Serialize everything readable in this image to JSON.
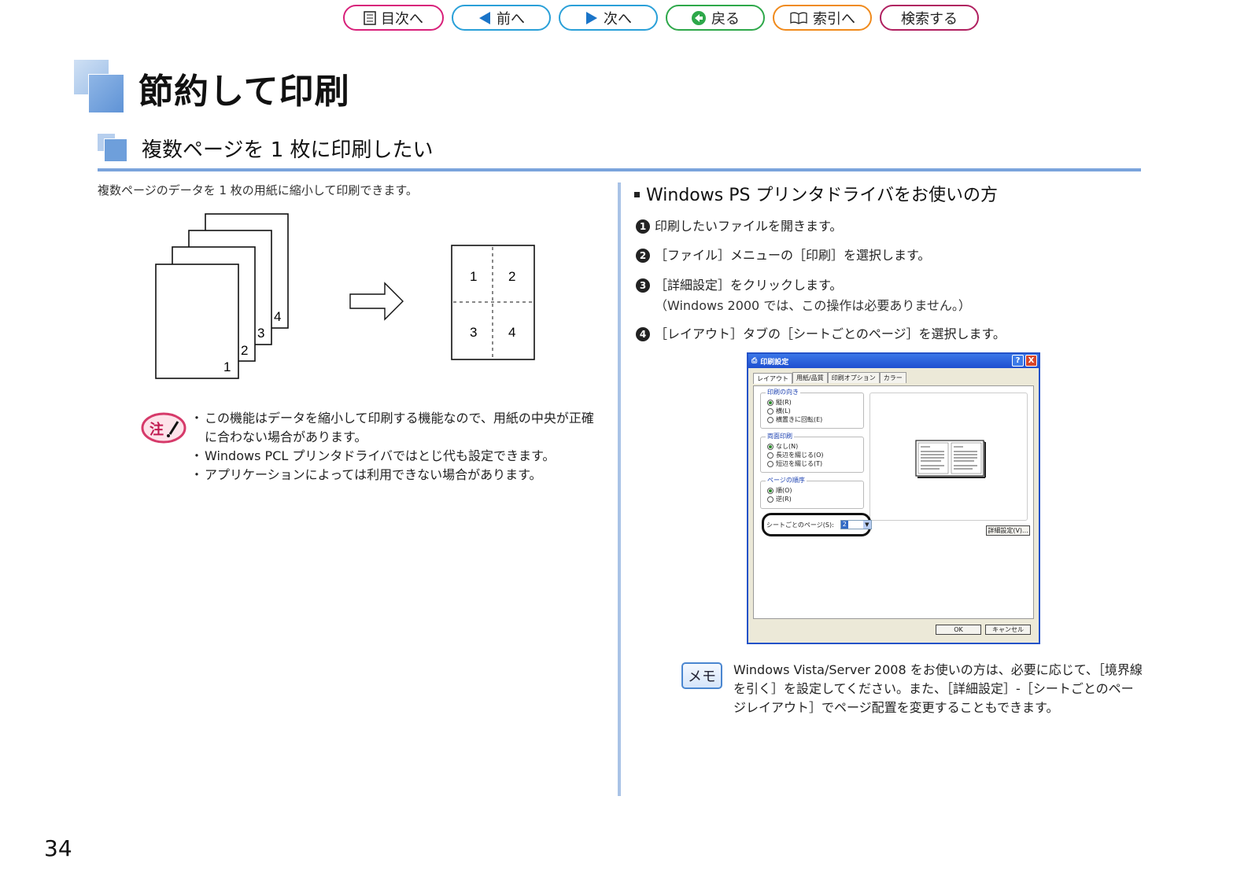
{
  "nav": {
    "toc": "目次へ",
    "prev": "前へ",
    "next": "次へ",
    "back": "戻る",
    "index": "索引へ",
    "search": "検索する",
    "colors": {
      "toc": "#d8207a",
      "prev": "#2aa0d8",
      "back": "#2ea84a",
      "index": "#f08a1c",
      "search": "#b02060"
    }
  },
  "page_title": "節約して印刷",
  "section_title": "複数ページを 1 枚に印刷したい",
  "intro": "複数ページのデータを 1 枚の用紙に縮小して印刷できます。",
  "diagram": {
    "stack_numbers": [
      "1",
      "2",
      "3",
      "4"
    ],
    "sheet_numbers": [
      "1",
      "2",
      "3",
      "4"
    ]
  },
  "note": {
    "icon_label": "注",
    "items": [
      "この機能はデータを縮小して印刷する機能なので、用紙の中央が正確に合わない場合があります。",
      "Windows PCL プリンタドライバではとじ代も設定できます。",
      "アプリケーションによっては利用できない場合があります。"
    ]
  },
  "right": {
    "subheading": "Windows PS プリンタドライバをお使いの方",
    "steps": [
      {
        "num": "1",
        "text": "印刷したいファイルを開きます。",
        "sub": ""
      },
      {
        "num": "2",
        "text": "［ファイル］メニューの［印刷］を選択します。",
        "sub": ""
      },
      {
        "num": "3",
        "text": "［詳細設定］をクリックします。",
        "sub": "（Windows 2000 では、この操作は必要ありません。）"
      },
      {
        "num": "4",
        "text": "［レイアウト］タブの［シートごとのページ］を選択します。",
        "sub": ""
      }
    ]
  },
  "dialog": {
    "title": "印刷設定",
    "help_btn": "?",
    "close_btn": "X",
    "tabs": [
      "レイアウト",
      "用紙/品質",
      "印刷オプション",
      "カラー"
    ],
    "orientation": {
      "legend": "印刷の向き",
      "options": [
        "縦(R)",
        "横(L)",
        "横置きに回転(E)"
      ]
    },
    "duplex": {
      "legend": "両面印刷",
      "options": [
        "なし(N)",
        "長辺を綴じる(O)",
        "短辺を綴じる(T)"
      ]
    },
    "order": {
      "legend": "ページの順序",
      "options": [
        "順(O)",
        "逆(R)"
      ]
    },
    "sheet_pages_label": "シートごとのページ(S):",
    "sheet_pages_value": "2",
    "detail_button": "詳細設定(V)...",
    "ok_button": "OK",
    "cancel_button": "キャンセル"
  },
  "memo": {
    "icon_label": "メモ",
    "text": "Windows Vista/Server 2008 をお使いの方は、必要に応じて、［境界線を引く］を設定してください。また、［詳細設定］-［シートごとのページレイアウト］でページ配置を変更することもできます。"
  },
  "page_number": "34"
}
